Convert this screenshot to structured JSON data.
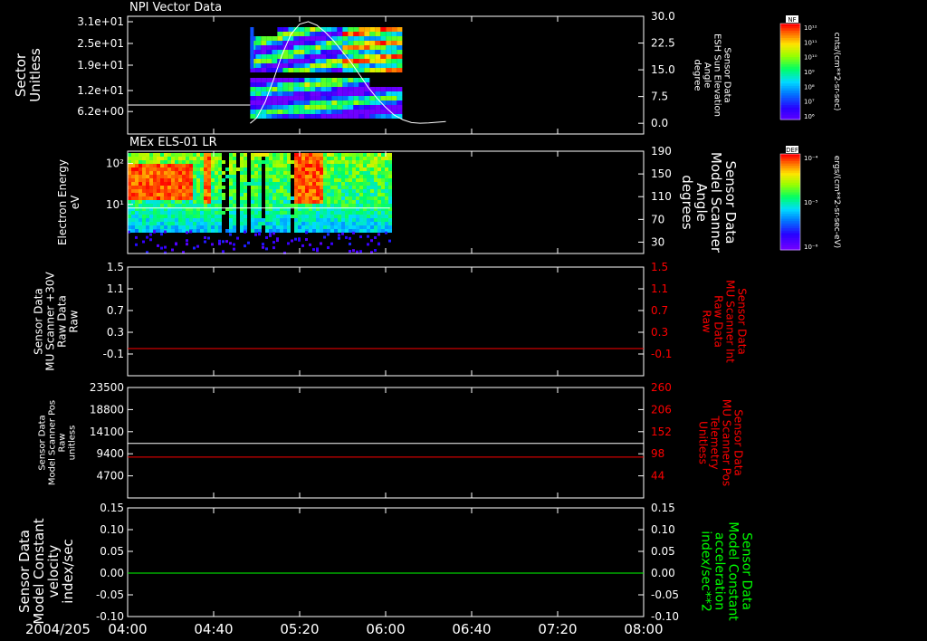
{
  "date_label": "2004/205",
  "x_ticks": [
    "04:00",
    "04:40",
    "05:20",
    "06:00",
    "06:40",
    "07:20",
    "08:00"
  ],
  "colorbars": [
    {
      "tag": "NF",
      "unit": "cnts/(cm**2-sr-sec)",
      "ticks": [
        "10¹²",
        "10¹¹",
        "10¹⁰",
        "10⁹",
        "10⁸",
        "10⁷",
        "10⁶"
      ]
    },
    {
      "tag": "DEF",
      "unit": "ergs/(cm**2-sr-sec-eV)",
      "ticks": [
        "10⁻⁴",
        "10⁻⁵",
        "10⁻⁶"
      ]
    }
  ],
  "chart_data": [
    {
      "type": "heatmap",
      "title": "NPI Vector Data",
      "ylabel": [
        "Sector",
        "Unitless"
      ],
      "yticks_left": [
        "3.1e+01",
        "2.5e+01",
        "1.9e+01",
        "1.2e+01",
        "6.2e+00"
      ],
      "yticks_right": [
        "30.0",
        "22.5",
        "15.0",
        "7.5",
        "0.0"
      ],
      "ylabel_right": [
        "Sensor Data",
        "ESH Sun Elevation",
        "Angle",
        "degree"
      ],
      "ylim_right": [
        -3,
        30
      ],
      "data_window": [
        "04:57",
        "06:06"
      ],
      "overlay_line": {
        "series": "Sensor Data ESH Sun Elevation Angle",
        "color": "#ffffff",
        "x": [
          "04:57",
          "05:00",
          "05:04",
          "05:08",
          "05:12",
          "05:16",
          "05:20",
          "05:24",
          "05:28",
          "05:32",
          "05:36",
          "05:40",
          "05:44",
          "05:48",
          "05:52",
          "05:56",
          "06:00",
          "06:04",
          "06:08",
          "06:12",
          "06:16",
          "06:20",
          "06:24",
          "06:28"
        ],
        "y": [
          0.0,
          1.5,
          6.0,
          12.5,
          19.5,
          25.0,
          27.8,
          28.5,
          27.5,
          25.5,
          23.0,
          20.0,
          17.0,
          13.5,
          10.0,
          7.0,
          4.5,
          2.3,
          1.0,
          0.2,
          0.0,
          0.1,
          0.3,
          0.5
        ]
      }
    },
    {
      "type": "heatmap",
      "title": "MEx ELS-01 LR",
      "ylabel": [
        "Electron Energy",
        "eV"
      ],
      "yticks_left": [
        "10²",
        "10¹"
      ],
      "ylim_left_log10": [
        -0.2,
        2.3
      ],
      "yticks_right": [
        "190",
        "150",
        "110",
        "70",
        "30"
      ],
      "ylabel_right": [
        "Sensor Data",
        "Model Scanner",
        "Angle",
        "degrees"
      ],
      "ylim_right": [
        10,
        190
      ],
      "data_window": [
        "04:00",
        "06:02"
      ],
      "overlay_line": {
        "series": "Sensor Data Model Scanner Angle",
        "color": "#ffffff",
        "x": [
          "04:00",
          "06:02"
        ],
        "y": [
          90,
          90
        ]
      }
    },
    {
      "type": "line",
      "ylabel": [
        "Sensor Data",
        "MU Scanner +30V",
        "Raw Data",
        "Raw"
      ],
      "yticks_left": [
        "1.5",
        "1.1",
        "0.7",
        "0.3",
        "-0.1"
      ],
      "yticks_right": [
        "1.5",
        "1.1",
        "0.7",
        "0.3",
        "-0.1"
      ],
      "ylabel_right": [
        "Sensor Data",
        "MU Scanner Int",
        "Raw Data",
        "Raw"
      ],
      "ylim": [
        -0.5,
        1.5
      ],
      "series": [
        {
          "name": "Sensor Data MU Scanner Int Raw Data",
          "color": "#ff0000",
          "x": [
            "04:00",
            "08:00"
          ],
          "y": [
            0,
            0
          ]
        }
      ]
    },
    {
      "type": "line",
      "ylabel": [
        "Sensor Data",
        "Model Scanner Pos",
        "Raw",
        "unitless"
      ],
      "yticks_left": [
        "23500",
        "18800",
        "14100",
        "9400",
        "4700"
      ],
      "yticks_right": [
        "260",
        "206",
        "152",
        "98",
        "44"
      ],
      "ylabel_right": [
        "Sensor Data",
        "MU Scanner Pos",
        "Telemetry",
        "Unitless"
      ],
      "ylim_left": [
        0,
        23500
      ],
      "ylim_right": [
        -10,
        260
      ],
      "series": [
        {
          "name": "Sensor Data Model Scanner Pos",
          "axis": "left",
          "color": "#ffffff",
          "x": [
            "04:00",
            "08:00"
          ],
          "y": [
            11600,
            11600
          ]
        },
        {
          "name": "Sensor Data MU Scanner Pos Telemetry",
          "axis": "right",
          "color": "#ff0000",
          "x": [
            "04:00",
            "08:00"
          ],
          "y": [
            90,
            90
          ]
        }
      ]
    },
    {
      "type": "line",
      "ylabel": [
        "Sensor Data",
        "Model Constant",
        "velocity",
        "index/sec"
      ],
      "yticks_left": [
        "0.15",
        "0.10",
        "0.05",
        "0.00",
        "-0.05",
        "-0.10"
      ],
      "yticks_right": [
        "0.15",
        "0.10",
        "0.05",
        "0.00",
        "-0.05",
        "-0.10"
      ],
      "ylabel_right": [
        "Sensor Data",
        "Model Constant",
        "acceleration",
        "index/sec**2"
      ],
      "ylim": [
        -0.1,
        0.15
      ],
      "series": [
        {
          "name": "Sensor Data Model Constant acceleration",
          "color": "#00ff00",
          "x": [
            "04:00",
            "08:00"
          ],
          "y": [
            0,
            0
          ]
        }
      ]
    }
  ]
}
